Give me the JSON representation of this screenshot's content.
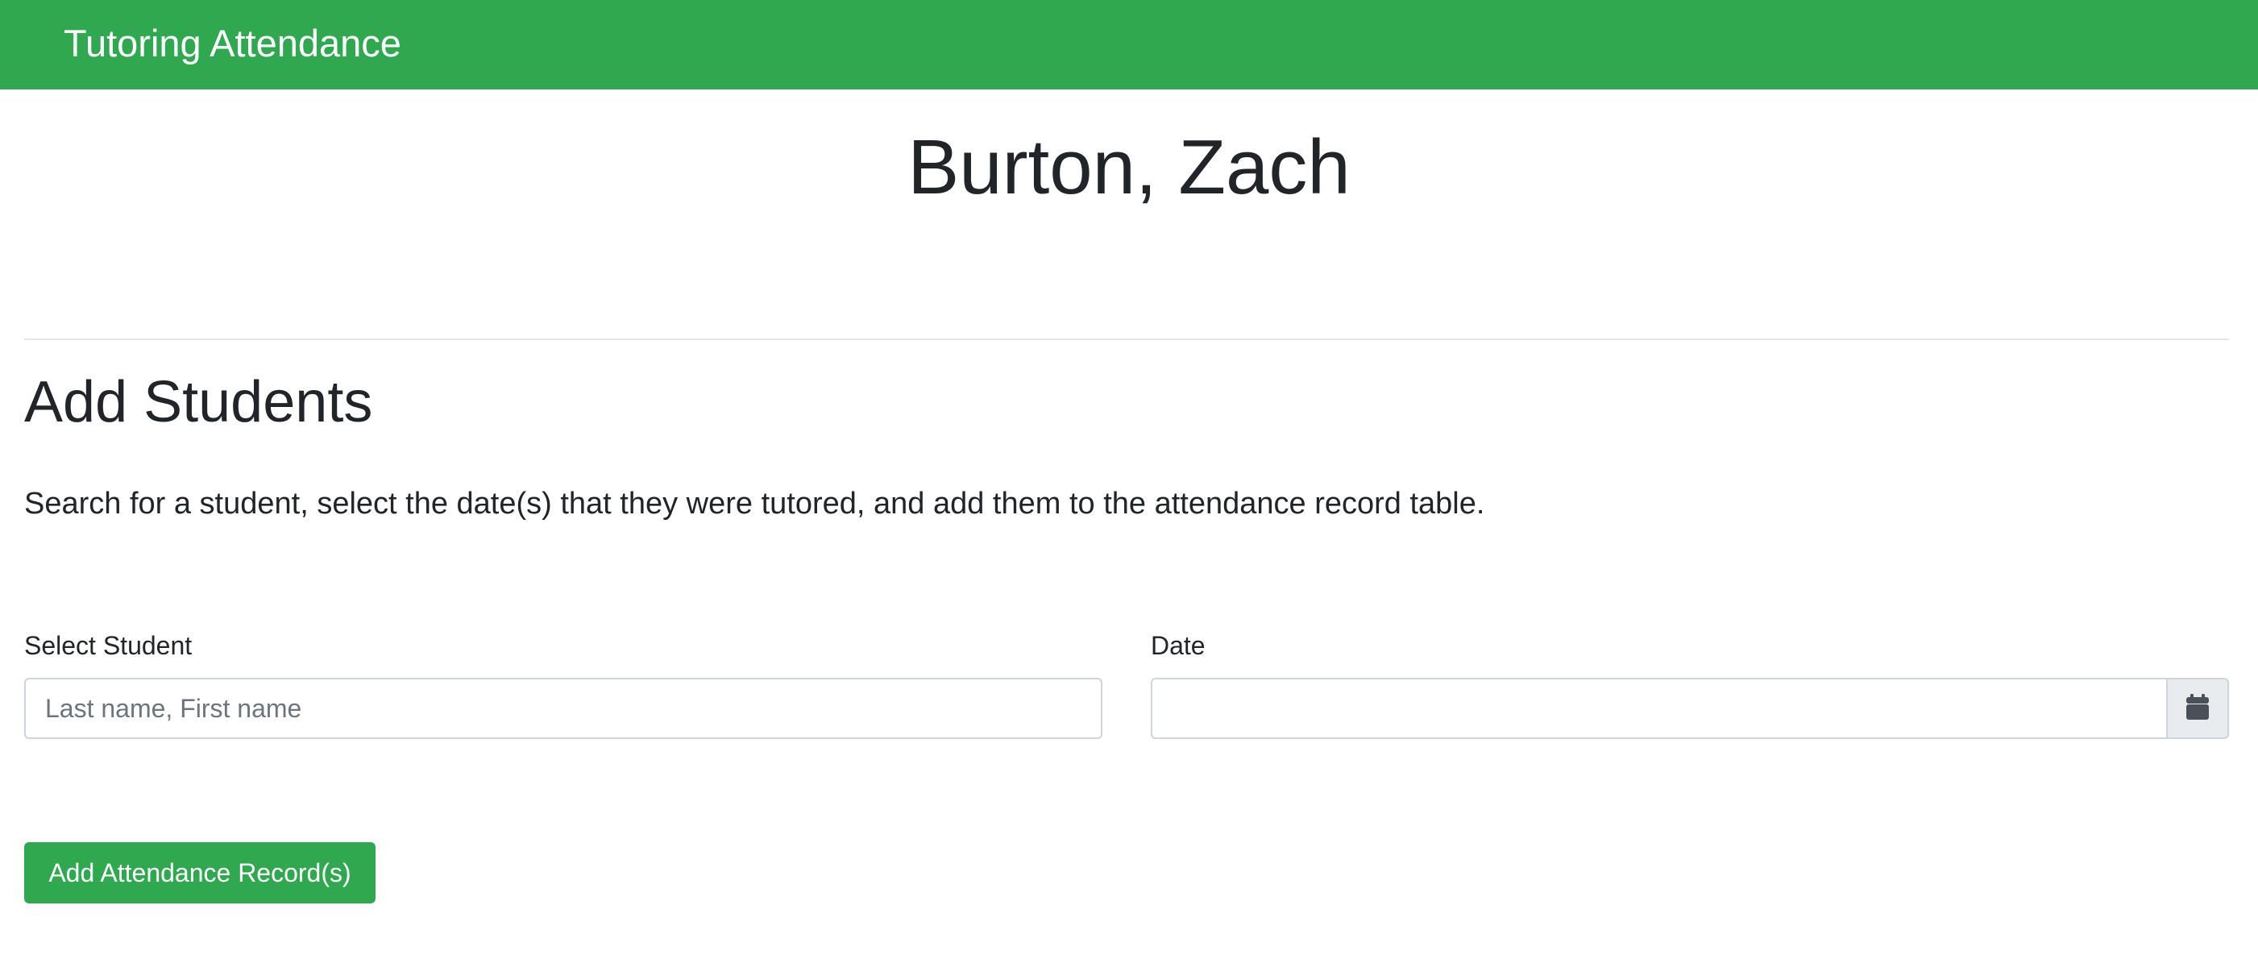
{
  "navbar": {
    "brand": "Tutoring Attendance",
    "background_color": "#2fa84f"
  },
  "page": {
    "title": "Burton, Zach"
  },
  "add_students": {
    "heading": "Add Students",
    "description": "Search for a student, select the date(s) that they were tutored, and add them to the attendance record table.",
    "student_field": {
      "label": "Select Student",
      "placeholder": "Last name, First name",
      "value": ""
    },
    "date_field": {
      "label": "Date",
      "value": "",
      "icon": "calendar-icon"
    },
    "submit_button": {
      "label": "Add Attendance Record(s)",
      "color": "#2fa84f"
    }
  }
}
